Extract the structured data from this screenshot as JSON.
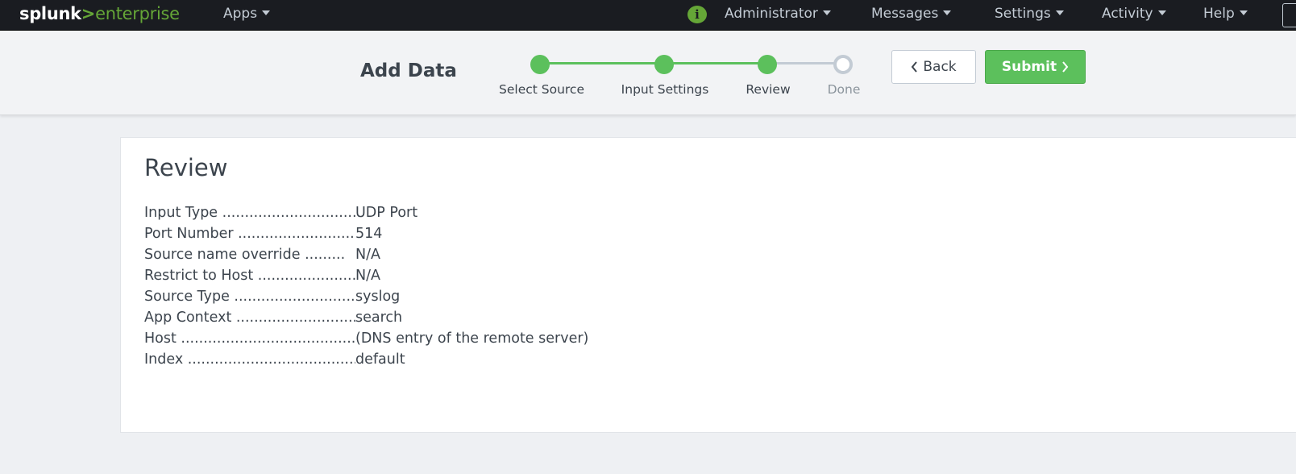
{
  "topbar": {
    "logo": {
      "part1": "splunk",
      "part2": ">",
      "part3": "enterprise"
    },
    "menu": {
      "apps": "Apps",
      "administrator": "Administrator",
      "messages": "Messages",
      "settings": "Settings",
      "activity": "Activity",
      "help": "Help"
    },
    "info_icon": "i"
  },
  "wizard": {
    "title": "Add Data",
    "steps": [
      {
        "label": "Select Source",
        "status": "complete"
      },
      {
        "label": "Input Settings",
        "status": "complete"
      },
      {
        "label": "Review",
        "status": "current"
      },
      {
        "label": "Done",
        "status": "pending"
      }
    ],
    "back_label": "Back",
    "submit_label": "Submit"
  },
  "review": {
    "title": "Review",
    "rows": [
      {
        "key": "Input Type ...............................",
        "value": "UDP Port"
      },
      {
        "key": "Port Number ...........................",
        "value": "514"
      },
      {
        "key": "Source name override .........",
        "value": "N/A"
      },
      {
        "key": "Restrict to Host ......................",
        "value": "N/A"
      },
      {
        "key": "Source Type ...........................",
        "value": "syslog"
      },
      {
        "key": "App Context ...........................",
        "value": "search"
      },
      {
        "key": "Host ..........................................",
        "value": "(DNS entry of the remote server)"
      },
      {
        "key": "Index .......................................",
        "value": "default"
      }
    ]
  },
  "colors": {
    "accent_green": "#5cc05c",
    "logo_green": "#65a637",
    "topbar_bg": "#1a1c21",
    "pending_gray": "#c3cbd4"
  },
  "icons": {
    "info": "info-icon",
    "caret": "caret-down-icon",
    "back": "chevron-left-icon",
    "submit": "chevron-right-icon"
  }
}
